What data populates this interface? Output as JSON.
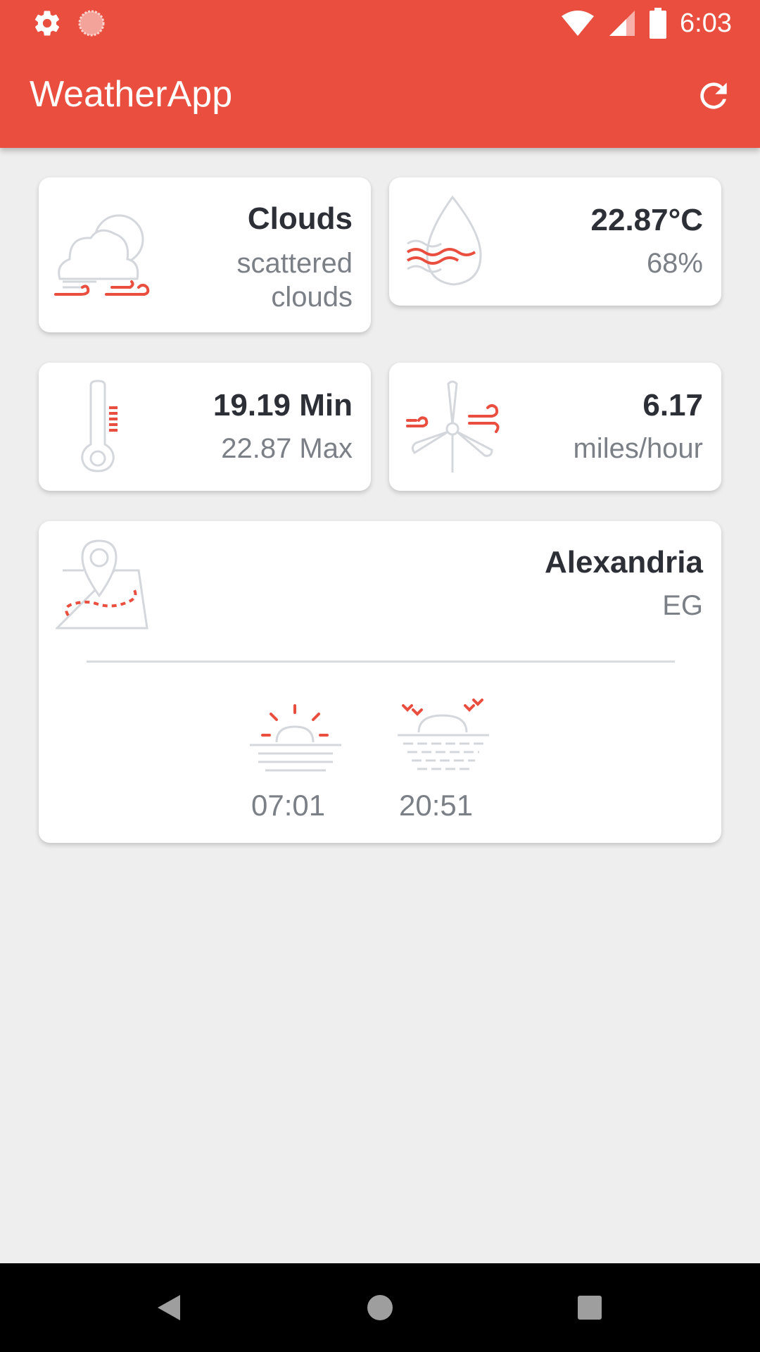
{
  "status_bar": {
    "time": "6:03",
    "left_icons": [
      "gear-icon",
      "sync-indicator-icon"
    ],
    "right_icons": [
      "wifi-icon",
      "signal-icon",
      "battery-icon"
    ]
  },
  "app_bar": {
    "title": "WeatherApp",
    "action_icon": "refresh-icon"
  },
  "cards": {
    "condition": {
      "main": "Clouds",
      "description_line1": "scattered",
      "description_line2": "clouds",
      "icon": "cloud-wind-icon"
    },
    "temp_humidity": {
      "temperature": "22.87°C",
      "humidity": "68%",
      "icon": "water-drop-icon"
    },
    "min_max": {
      "min": "19.19 Min",
      "max": "22.87 Max",
      "icon": "thermometer-icon"
    },
    "wind": {
      "speed": "6.17",
      "unit": "miles/hour",
      "icon": "wind-turbine-icon"
    },
    "location": {
      "city": "Alexandria",
      "country": "EG",
      "icon": "map-pin-icon",
      "sunrise": "07:01",
      "sunset": "20:51"
    }
  },
  "nav_bar": {
    "buttons": [
      "back-icon",
      "home-icon",
      "recents-icon"
    ]
  },
  "colors": {
    "primary": "#e94e3f",
    "background": "#eeeeee",
    "icon_grey": "#d4d7db",
    "icon_accent": "#e94e3f"
  }
}
